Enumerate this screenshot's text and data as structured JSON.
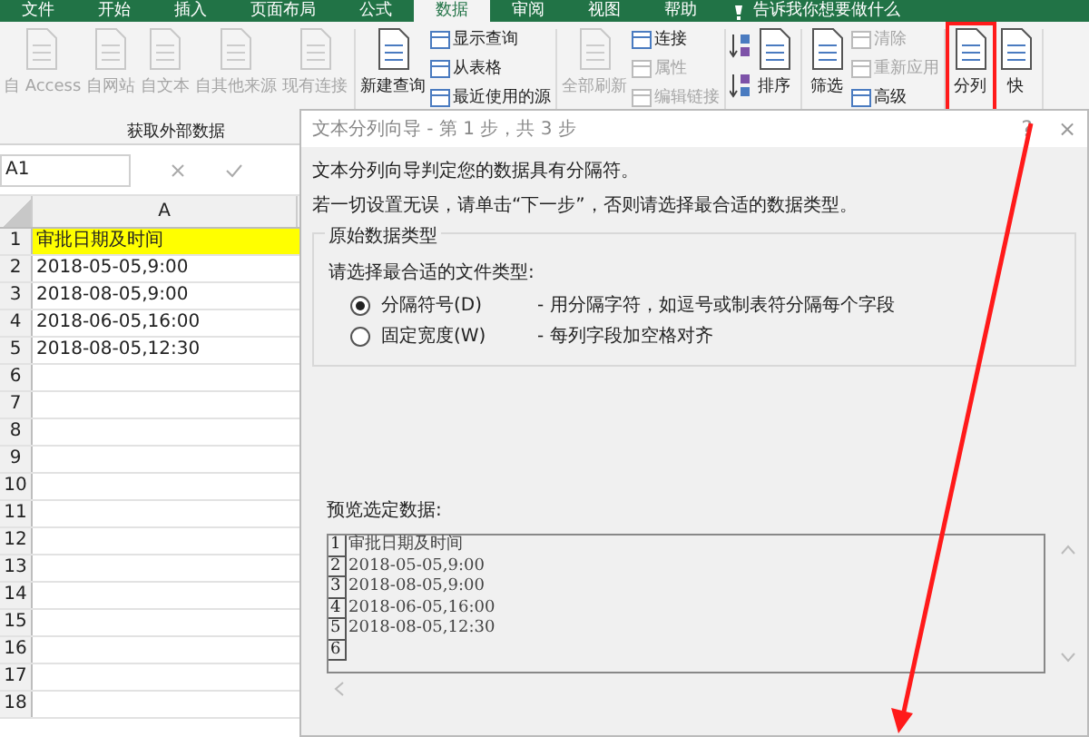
{
  "ribbon_tabs": [
    {
      "label": "文件",
      "selected": false
    },
    {
      "label": "开始",
      "selected": false
    },
    {
      "label": "插入",
      "selected": false
    },
    {
      "label": "页面布局",
      "selected": false
    },
    {
      "label": "公式",
      "selected": false
    },
    {
      "label": "数据",
      "selected": true
    },
    {
      "label": "审阅",
      "selected": false
    },
    {
      "label": "视图",
      "selected": false
    },
    {
      "label": "帮助",
      "selected": false
    }
  ],
  "tell_me": "告诉我你想要做什么",
  "ribbon_groups": [
    {
      "label": "获取外部数据",
      "columns": [
        {
          "kind": "large",
          "label": "自 Access",
          "disabled": true
        },
        {
          "kind": "large",
          "label": "自网站",
          "disabled": true
        },
        {
          "kind": "large",
          "label": "自文本",
          "disabled": true
        },
        {
          "kind": "large",
          "label": "自其他来源",
          "disabled": true
        },
        {
          "kind": "large",
          "label": "现有连接",
          "disabled": true
        }
      ]
    },
    {
      "columns": [
        {
          "kind": "large",
          "label": "新建查询",
          "disabled": false
        },
        {
          "kind": "stack",
          "items": [
            {
              "label": "显示查询",
              "disabled": false
            },
            {
              "label": "从表格",
              "disabled": false
            },
            {
              "label": "最近使用的源",
              "disabled": false
            }
          ]
        }
      ]
    },
    {
      "columns": [
        {
          "kind": "large",
          "label": "全部刷新",
          "disabled": true
        },
        {
          "kind": "stack",
          "items": [
            {
              "label": "连接",
              "disabled": false
            },
            {
              "label": "属性",
              "disabled": true
            },
            {
              "label": "编辑链接",
              "disabled": true
            }
          ]
        }
      ]
    },
    {
      "columns": [
        {
          "kind": "sort"
        },
        {
          "kind": "large",
          "label": "排序",
          "disabled": false
        }
      ]
    },
    {
      "columns": [
        {
          "kind": "large",
          "label": "筛选",
          "disabled": false
        },
        {
          "kind": "stack",
          "items": [
            {
              "label": "清除",
              "disabled": true
            },
            {
              "label": "重新应用",
              "disabled": true
            },
            {
              "label": "高级",
              "disabled": false
            }
          ]
        }
      ]
    },
    {
      "columns": [
        {
          "kind": "large",
          "label": "分列",
          "disabled": false,
          "highlighted": true
        },
        {
          "kind": "large",
          "label": "快",
          "disabled": false
        }
      ]
    }
  ],
  "name_box": "A1",
  "sheet": {
    "column": "A",
    "rows": [
      {
        "number": "1",
        "value": "审批日期及时间",
        "highlighted": true
      },
      {
        "number": "2",
        "value": "2018-05-05,9:00",
        "highlighted": false
      },
      {
        "number": "3",
        "value": "2018-08-05,9:00",
        "highlighted": false
      },
      {
        "number": "4",
        "value": "2018-06-05,16:00",
        "highlighted": false
      },
      {
        "number": "5",
        "value": "2018-08-05,12:30",
        "highlighted": false
      },
      {
        "number": "6",
        "highlighted": false
      },
      {
        "number": "7",
        "highlighted": false
      },
      {
        "number": "8",
        "highlighted": false
      },
      {
        "number": "9",
        "highlighted": false
      },
      {
        "number": "10",
        "highlighted": false
      },
      {
        "number": "11",
        "highlighted": false
      },
      {
        "number": "12",
        "highlighted": false
      },
      {
        "number": "13",
        "highlighted": false
      },
      {
        "number": "14",
        "highlighted": false
      },
      {
        "number": "15",
        "highlighted": false
      },
      {
        "number": "16",
        "highlighted": false
      },
      {
        "number": "17",
        "highlighted": false
      },
      {
        "number": "18",
        "highlighted": false
      }
    ]
  },
  "dialog": {
    "title": "文本分列向导 - 第 1 步，共 3 步",
    "help": "?",
    "close": "×",
    "intro": [
      "文本分列向导判定您的数据具有分隔符。",
      "若一切设置无误，请单击“下一步”，否则请选择最合适的数据类型。"
    ],
    "group_title": "原始数据类型",
    "prompt": "请选择最合适的文件类型:",
    "options": [
      {
        "label": "分隔符号(D)",
        "description": "- 用分隔字符，如逗号或制表符分隔每个字段",
        "selected": true
      },
      {
        "label": "固定宽度(W)",
        "description": "- 每列字段加空格对齐",
        "selected": false
      }
    ],
    "preview_label": "预览选定数据:",
    "preview_rows": [
      {
        "number": "1",
        "text": "审批日期及时间"
      },
      {
        "number": "2",
        "text": "2018-05-05,9:00"
      },
      {
        "number": "3",
        "text": "2018-08-05,9:00"
      },
      {
        "number": "4",
        "text": "2018-06-05,16:00"
      },
      {
        "number": "5",
        "text": "2018-08-05,12:30"
      },
      {
        "number": "6"
      }
    ]
  }
}
